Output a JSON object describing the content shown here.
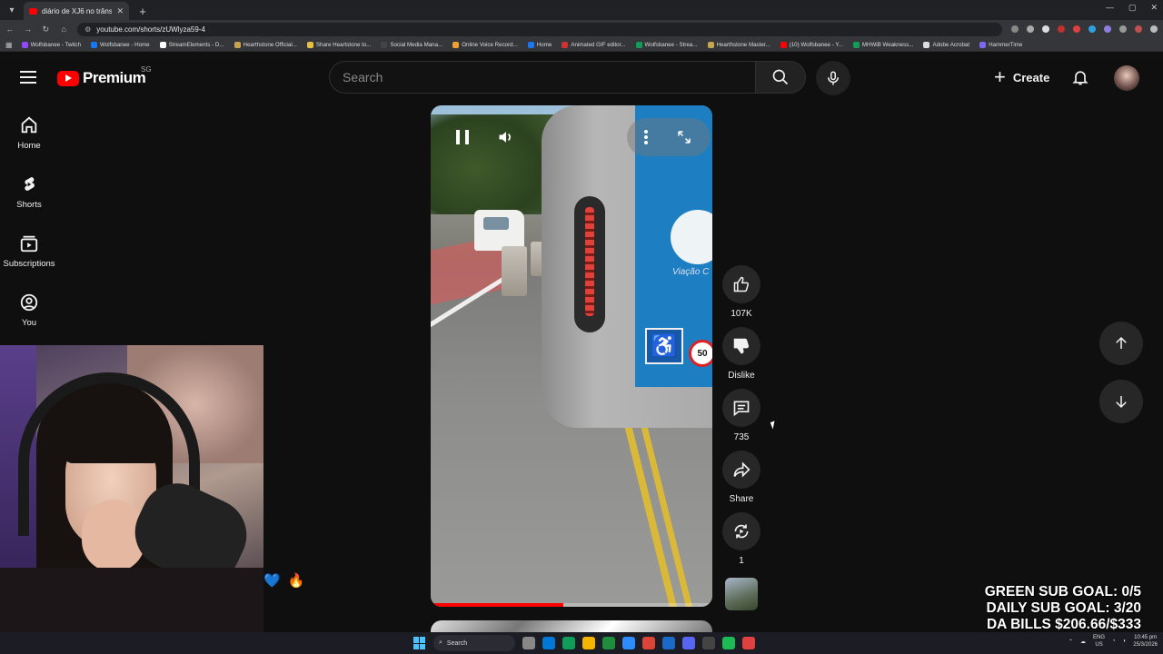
{
  "browser": {
    "tab_title": "diário de XJ6 no trânsito 💙 🔊",
    "url": "youtube.com/shorts/zUWlyza59-4",
    "bookmarks": [
      {
        "label": "Wolfsbanee - Twitch",
        "color": "#9146ff"
      },
      {
        "label": "Wolfsbanee - Home",
        "color": "#1877f2"
      },
      {
        "label": "StreamElements - D...",
        "color": "#ffffff"
      },
      {
        "label": "Hearthstone Official...",
        "color": "#c9a450"
      },
      {
        "label": "Share Heartstone to...",
        "color": "#e8c040"
      },
      {
        "label": "Social Media Mana...",
        "color": "#444444"
      },
      {
        "label": "Online Voice Record...",
        "color": "#f0a030"
      },
      {
        "label": "Home",
        "color": "#1877f2"
      },
      {
        "label": "Animated GIF editor...",
        "color": "#cc3333"
      },
      {
        "label": "Wolfsbanee - Strea...",
        "color": "#0f9d58"
      },
      {
        "label": "Hearthstone Master...",
        "color": "#c9a450"
      },
      {
        "label": "(10) Wolfsbanee - Y...",
        "color": "#ff0000"
      },
      {
        "label": "MHWiB Weakness...",
        "color": "#0f9d58"
      },
      {
        "label": "Adobe Acrobat",
        "color": "#dddddd"
      },
      {
        "label": "HammerTime",
        "color": "#7b68ee"
      }
    ]
  },
  "youtube": {
    "brand": "Premium",
    "region": "SG",
    "search_placeholder": "Search",
    "create_label": "Create",
    "sidebar": [
      {
        "label": "Home",
        "icon": "home-icon"
      },
      {
        "label": "Shorts",
        "icon": "shorts-icon"
      },
      {
        "label": "Subscriptions",
        "icon": "subscriptions-icon"
      },
      {
        "label": "You",
        "icon": "account-icon"
      }
    ],
    "short": {
      "bus_text": "Viação C",
      "speed_sign": "50",
      "progress_fraction": 0.47
    },
    "actions": {
      "likes": "107K",
      "dislike_label": "Dislike",
      "comments": "735",
      "share_label": "Share",
      "remix_count": "1"
    }
  },
  "overlay": {
    "goals": [
      "GREEN SUB GOAL: 0/5",
      "DAILY SUB GOAL: 3/20",
      "DA BILLS $206.66/$333"
    ],
    "emotes": [
      "💙",
      "🔥"
    ]
  },
  "taskbar": {
    "search_label": "Search",
    "lang": "ENG",
    "region": "US",
    "time": "10:45 pm",
    "date": "25/3/2026",
    "app_colors": [
      "#888888",
      "#0078d4",
      "#0f9d58",
      "#f4b400",
      "#1e8e3e",
      "#2d8cff",
      "#db4437",
      "#1b6ac9",
      "#5865f2",
      "#444444",
      "#1db954",
      "#e04040"
    ]
  }
}
